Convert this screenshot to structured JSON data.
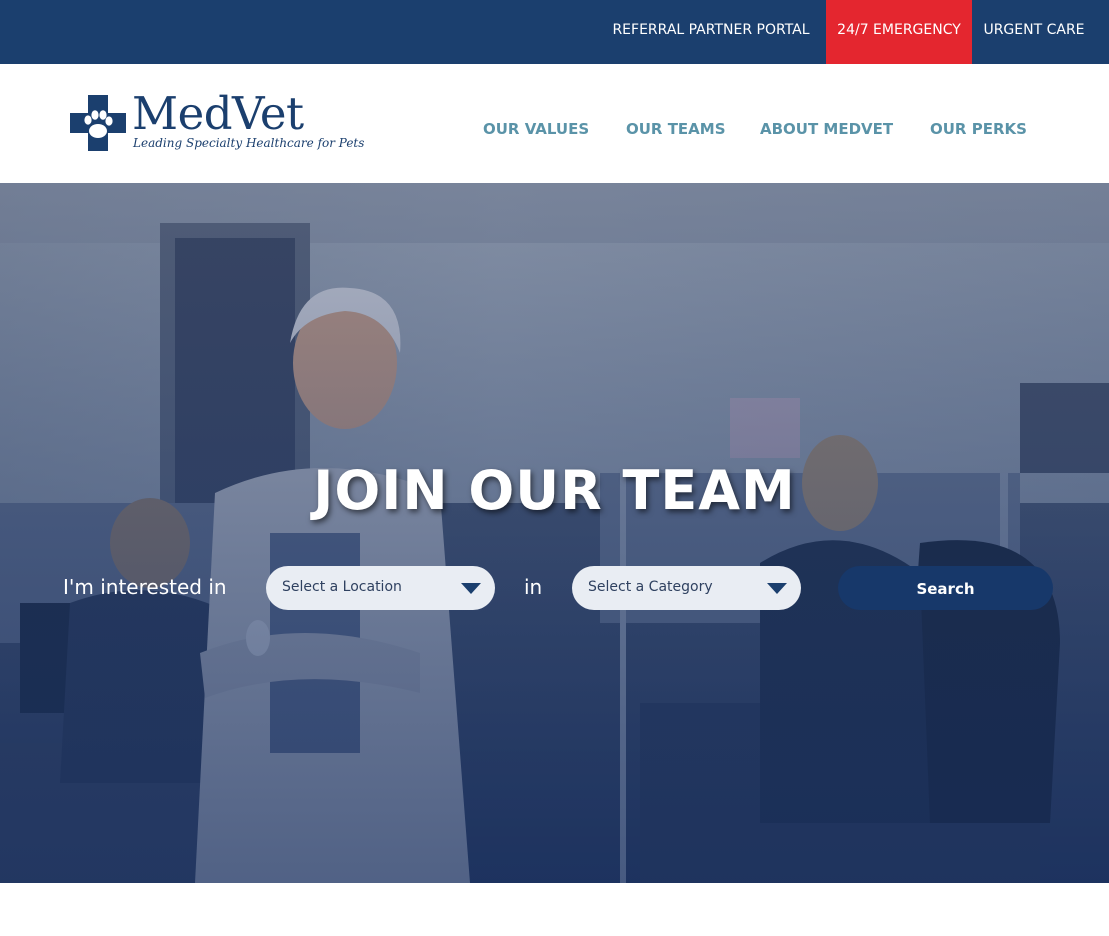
{
  "topbar": {
    "referral_label": "REFERRAL PARTNER PORTAL",
    "emergency_label": "24/7 EMERGENCY",
    "urgent_label": "URGENT CARE",
    "bg_color": "#1b3f6e",
    "emergency_color": "#e4262f"
  },
  "header": {
    "logo_word": "MedVet",
    "logo_tagline": "Leading Specialty Healthcare for Pets",
    "logo_icon": "cross-paw-icon",
    "nav": {
      "values": "OUR VALUES",
      "teams": "OUR TEAMS",
      "about": "ABOUT MEDVET",
      "perks": "OUR PERKS"
    },
    "nav_color": "#5a93a8"
  },
  "hero": {
    "title": "JOIN OUR TEAM",
    "interest_label": "I'm interested in",
    "in_label": "in",
    "location_select": "Select a Location",
    "category_select": "Select a Category",
    "search_label": "Search",
    "button_color": "#17386a"
  }
}
